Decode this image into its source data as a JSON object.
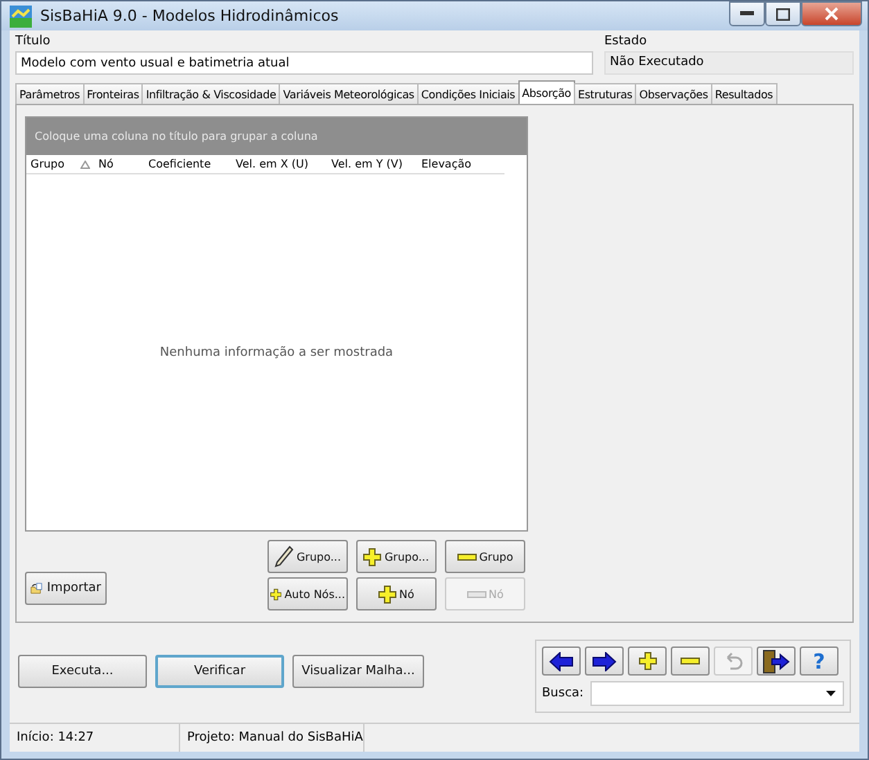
{
  "window": {
    "title": "SisBaHiA 9.0 - Modelos Hidrodinâmicos"
  },
  "title_field": {
    "label": "Título",
    "value": "Modelo com vento usual e batimetria atual"
  },
  "state_field": {
    "label": "Estado",
    "value": "Não Executado"
  },
  "tabs": [
    {
      "label": "Parâmetros",
      "selected": false
    },
    {
      "label": "Fronteiras",
      "selected": false
    },
    {
      "label": "Infiltração & Viscosidade",
      "selected": false
    },
    {
      "label": "Variáveis Meteorológicas",
      "selected": false
    },
    {
      "label": "Condições Iniciais",
      "selected": false
    },
    {
      "label": "Absorção",
      "selected": true
    },
    {
      "label": "Estruturas",
      "selected": false
    },
    {
      "label": "Observações",
      "selected": false
    },
    {
      "label": "Resultados",
      "selected": false
    }
  ],
  "grid": {
    "group_hint": "Coloque uma coluna no título para grupar a coluna",
    "columns": [
      "Grupo",
      "Nó",
      "Coeficiente",
      "Vel. em X (U)",
      "Vel. em Y (V)",
      "Elevação"
    ],
    "empty_message": "Nenhuma informação a ser mostrada"
  },
  "import_button": {
    "label": "Importar"
  },
  "action_buttons": [
    {
      "kind": "edit",
      "label": "Grupo...",
      "disabled": false
    },
    {
      "kind": "add",
      "label": "Grupo...",
      "disabled": false
    },
    {
      "kind": "remove",
      "label": "Grupo",
      "disabled": false
    },
    {
      "kind": "add",
      "label": "Auto Nós...",
      "disabled": false
    },
    {
      "kind": "add",
      "label": "Nó",
      "disabled": false
    },
    {
      "kind": "remove",
      "label": "Nó",
      "disabled": true
    }
  ],
  "bottom_buttons": [
    {
      "label": "Executa...",
      "selected": false
    },
    {
      "label": "Verificar",
      "selected": true
    },
    {
      "label": "Visualizar Malha...",
      "selected": false
    }
  ],
  "nav_buttons": [
    {
      "kind": "left",
      "disabled": false
    },
    {
      "kind": "right",
      "disabled": false
    },
    {
      "kind": "add",
      "disabled": false
    },
    {
      "kind": "remove",
      "disabled": false
    },
    {
      "kind": "undo",
      "disabled": true
    },
    {
      "kind": "exit",
      "disabled": false
    },
    {
      "kind": "help",
      "label": "?",
      "disabled": false
    }
  ],
  "search": {
    "label": "Busca:"
  },
  "status_bar": [
    "Início: 14:27",
    "Projeto: Manual do SisBaHiA"
  ]
}
